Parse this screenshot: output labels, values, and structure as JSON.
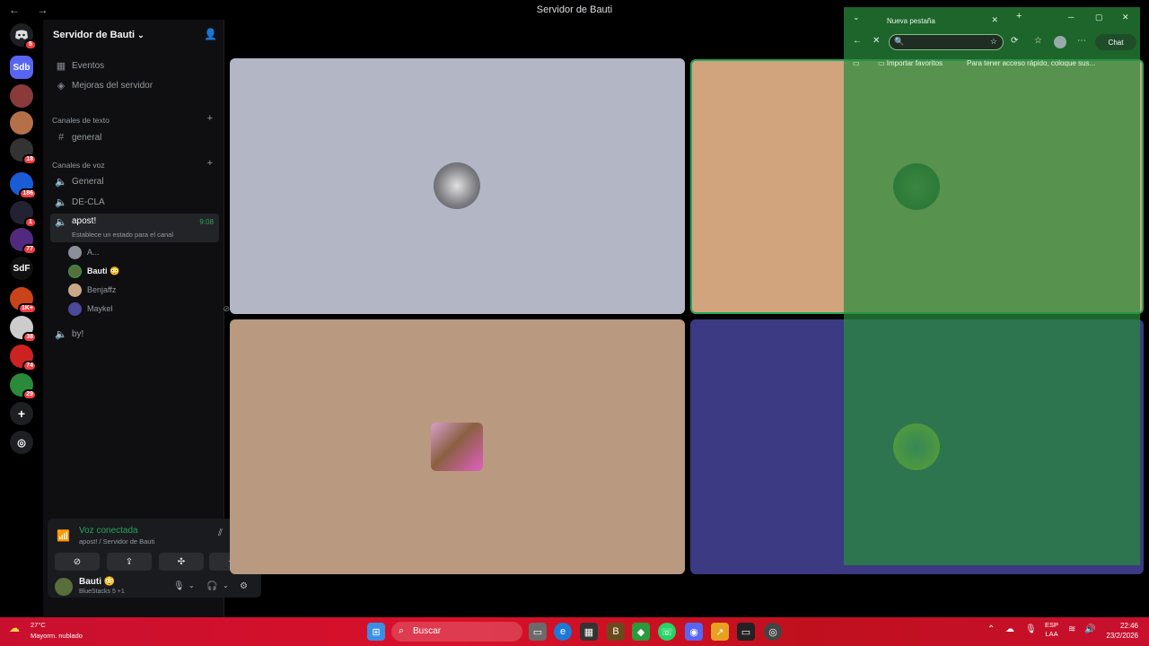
{
  "window": {
    "title": "Servidor de Bauti",
    "nav_glyphs": "← →"
  },
  "server_rail": {
    "items": [
      {
        "label": "",
        "icon": "discord-icon",
        "badge": "5",
        "color": "#5865f2"
      },
      {
        "label": "Sdb",
        "icon": "",
        "badge": "",
        "color": "#5865f2"
      },
      {
        "label": "",
        "icon": "",
        "badge": "",
        "color": "#a33"
      },
      {
        "label": "",
        "icon": "",
        "badge": "",
        "color": "#b5704a"
      },
      {
        "label": "",
        "icon": "",
        "badge": "18",
        "color": "#333"
      },
      {
        "label": "",
        "icon": "",
        "badge": "186",
        "color": "#1a5cd6"
      },
      {
        "label": "",
        "icon": "",
        "badge": "1",
        "color": "#223"
      },
      {
        "label": "",
        "icon": "",
        "badge": "77",
        "color": "#512a80"
      },
      {
        "label": "SdF",
        "icon": "",
        "badge": "",
        "color": "#111"
      },
      {
        "label": "",
        "icon": "",
        "badge": "1K+",
        "color": "#c8431a"
      },
      {
        "label": "",
        "icon": "",
        "badge": "38",
        "color": "#ddd"
      },
      {
        "label": "",
        "icon": "",
        "badge": "74",
        "color": "#c22"
      },
      {
        "label": "",
        "icon": "",
        "badge": "29",
        "color": "#2a8a3a"
      }
    ],
    "add_icon": "plus-icon",
    "explore_icon": "compass-icon"
  },
  "sidebar": {
    "server_name": "Servidor de Bauti",
    "events": "Eventos",
    "boosts": "Mejoras del servidor",
    "text_category": "Canales de texto",
    "text_channels": [
      "general"
    ],
    "voice_category": "Canales de voz",
    "voice_channels": [
      "General",
      "DE-CLA"
    ],
    "active_channel": {
      "name": "apost!",
      "time": "9:08",
      "status": "Establece un estado para el canal"
    },
    "members": [
      "A...",
      "Bauti 😳",
      "Benjaffz",
      "Maykel"
    ],
    "extra_channel": "by!"
  },
  "voice_panel": {
    "title": "Voz conectada",
    "subtitle": "apost! / Servidor de Bauti",
    "user_name": "Bauti 😳",
    "activity": "BlueStacks 5 +1"
  },
  "browser": {
    "tab_title": "Nueva pestaña",
    "chat_label": "Chat",
    "bookmark_import": "Importar favoritos",
    "bookmark_hint": "Para tener acceso rápido, coloque sus..."
  },
  "taskbar": {
    "temp": "27°C",
    "condition": "Mayorm. nublado",
    "search": "Buscar",
    "lang1": "ESP",
    "lang2": "LAA",
    "time": "22:46",
    "date": "23/2/2026"
  },
  "colors": {
    "tile1": "#b3b6c4",
    "tile2": "#d1a47e",
    "tile3": "#b99a80",
    "tile4": "#3c3a82",
    "accent_green": "#23a55a"
  }
}
